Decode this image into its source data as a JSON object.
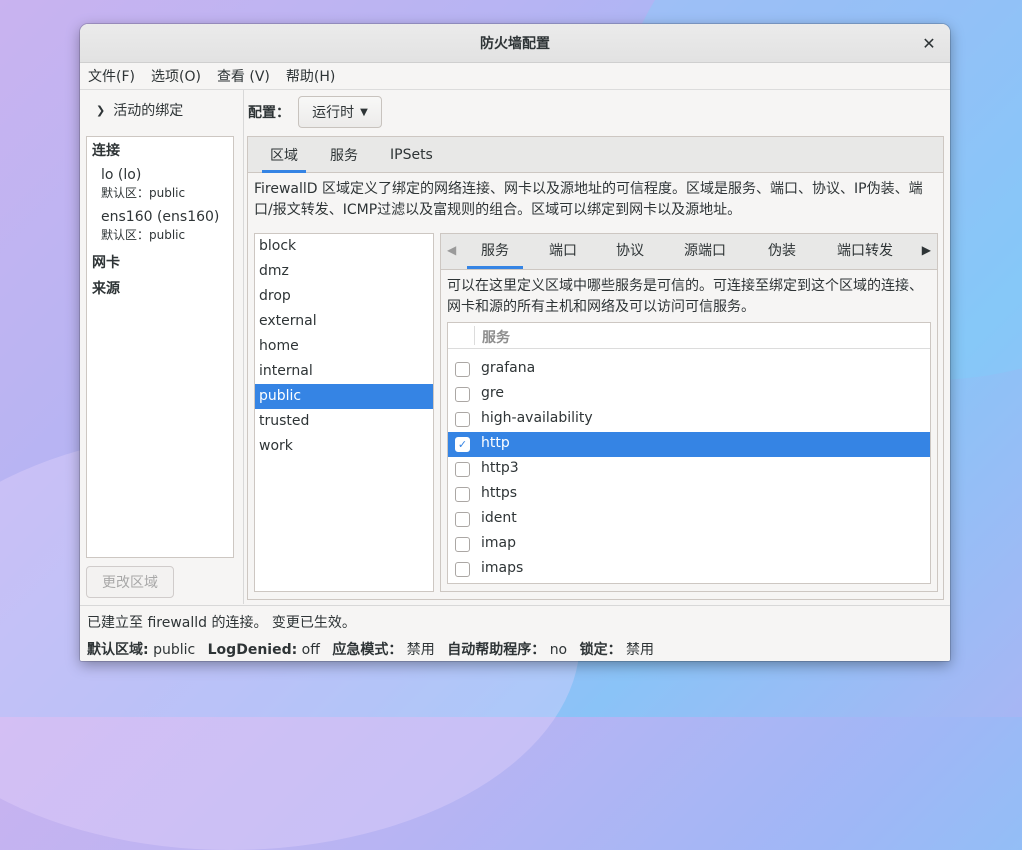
{
  "window": {
    "title": "防火墙配置"
  },
  "menu": [
    "文件(F)",
    "选项(O)",
    "查看 (V)",
    "帮助(H)"
  ],
  "sidebar": {
    "header": "活动的绑定",
    "connections_label": "连接",
    "connections": [
      {
        "name": "lo (lo)",
        "zone": "默认区：public"
      },
      {
        "name": "ens160 (ens160)",
        "zone": "默认区：public"
      }
    ],
    "interfaces_label": "网卡",
    "sources_label": "来源",
    "change_zone_button": "更改区域"
  },
  "config": {
    "label": "配置：",
    "value": "运行时"
  },
  "tabs": [
    "区域",
    "服务",
    "IPSets"
  ],
  "zone_description": "FirewallD 区域定义了绑定的网络连接、网卡以及源地址的可信程度。区域是服务、端口、协议、IP伪装、端口/报文转发、ICMP过滤以及富规则的组合。区域可以绑定到网卡以及源地址。",
  "zones": [
    "block",
    "dmz",
    "drop",
    "external",
    "home",
    "internal",
    "public",
    "trusted",
    "work"
  ],
  "selected_zone": "public",
  "inner_tabs": [
    "服务",
    "端口",
    "协议",
    "源端口",
    "伪装",
    "端口转发"
  ],
  "services_description": "可以在这里定义区域中哪些服务是可信的。可连接至绑定到这个区域的连接、网卡和源的所有主机和网络及可以访问可信服务。",
  "services_header": "服务",
  "services": [
    {
      "name": "grafana",
      "checked": false
    },
    {
      "name": "gre",
      "checked": false
    },
    {
      "name": "high-availability",
      "checked": false
    },
    {
      "name": "http",
      "checked": true
    },
    {
      "name": "http3",
      "checked": false
    },
    {
      "name": "https",
      "checked": false
    },
    {
      "name": "ident",
      "checked": false
    },
    {
      "name": "imap",
      "checked": false
    },
    {
      "name": "imaps",
      "checked": false
    }
  ],
  "status": {
    "line1": "已建立至 firewalld 的连接。 变更已生效。",
    "default_zone_label": "默认区域:",
    "default_zone": "public",
    "log_denied_label": "LogDenied:",
    "log_denied": "off",
    "panic_label": "应急模式：",
    "panic": "禁用",
    "helper_label": "自动帮助程序：",
    "helper": "no",
    "lockdown_label": "锁定：",
    "lockdown": "禁用"
  },
  "colors": {
    "accent": "#3584e4"
  }
}
